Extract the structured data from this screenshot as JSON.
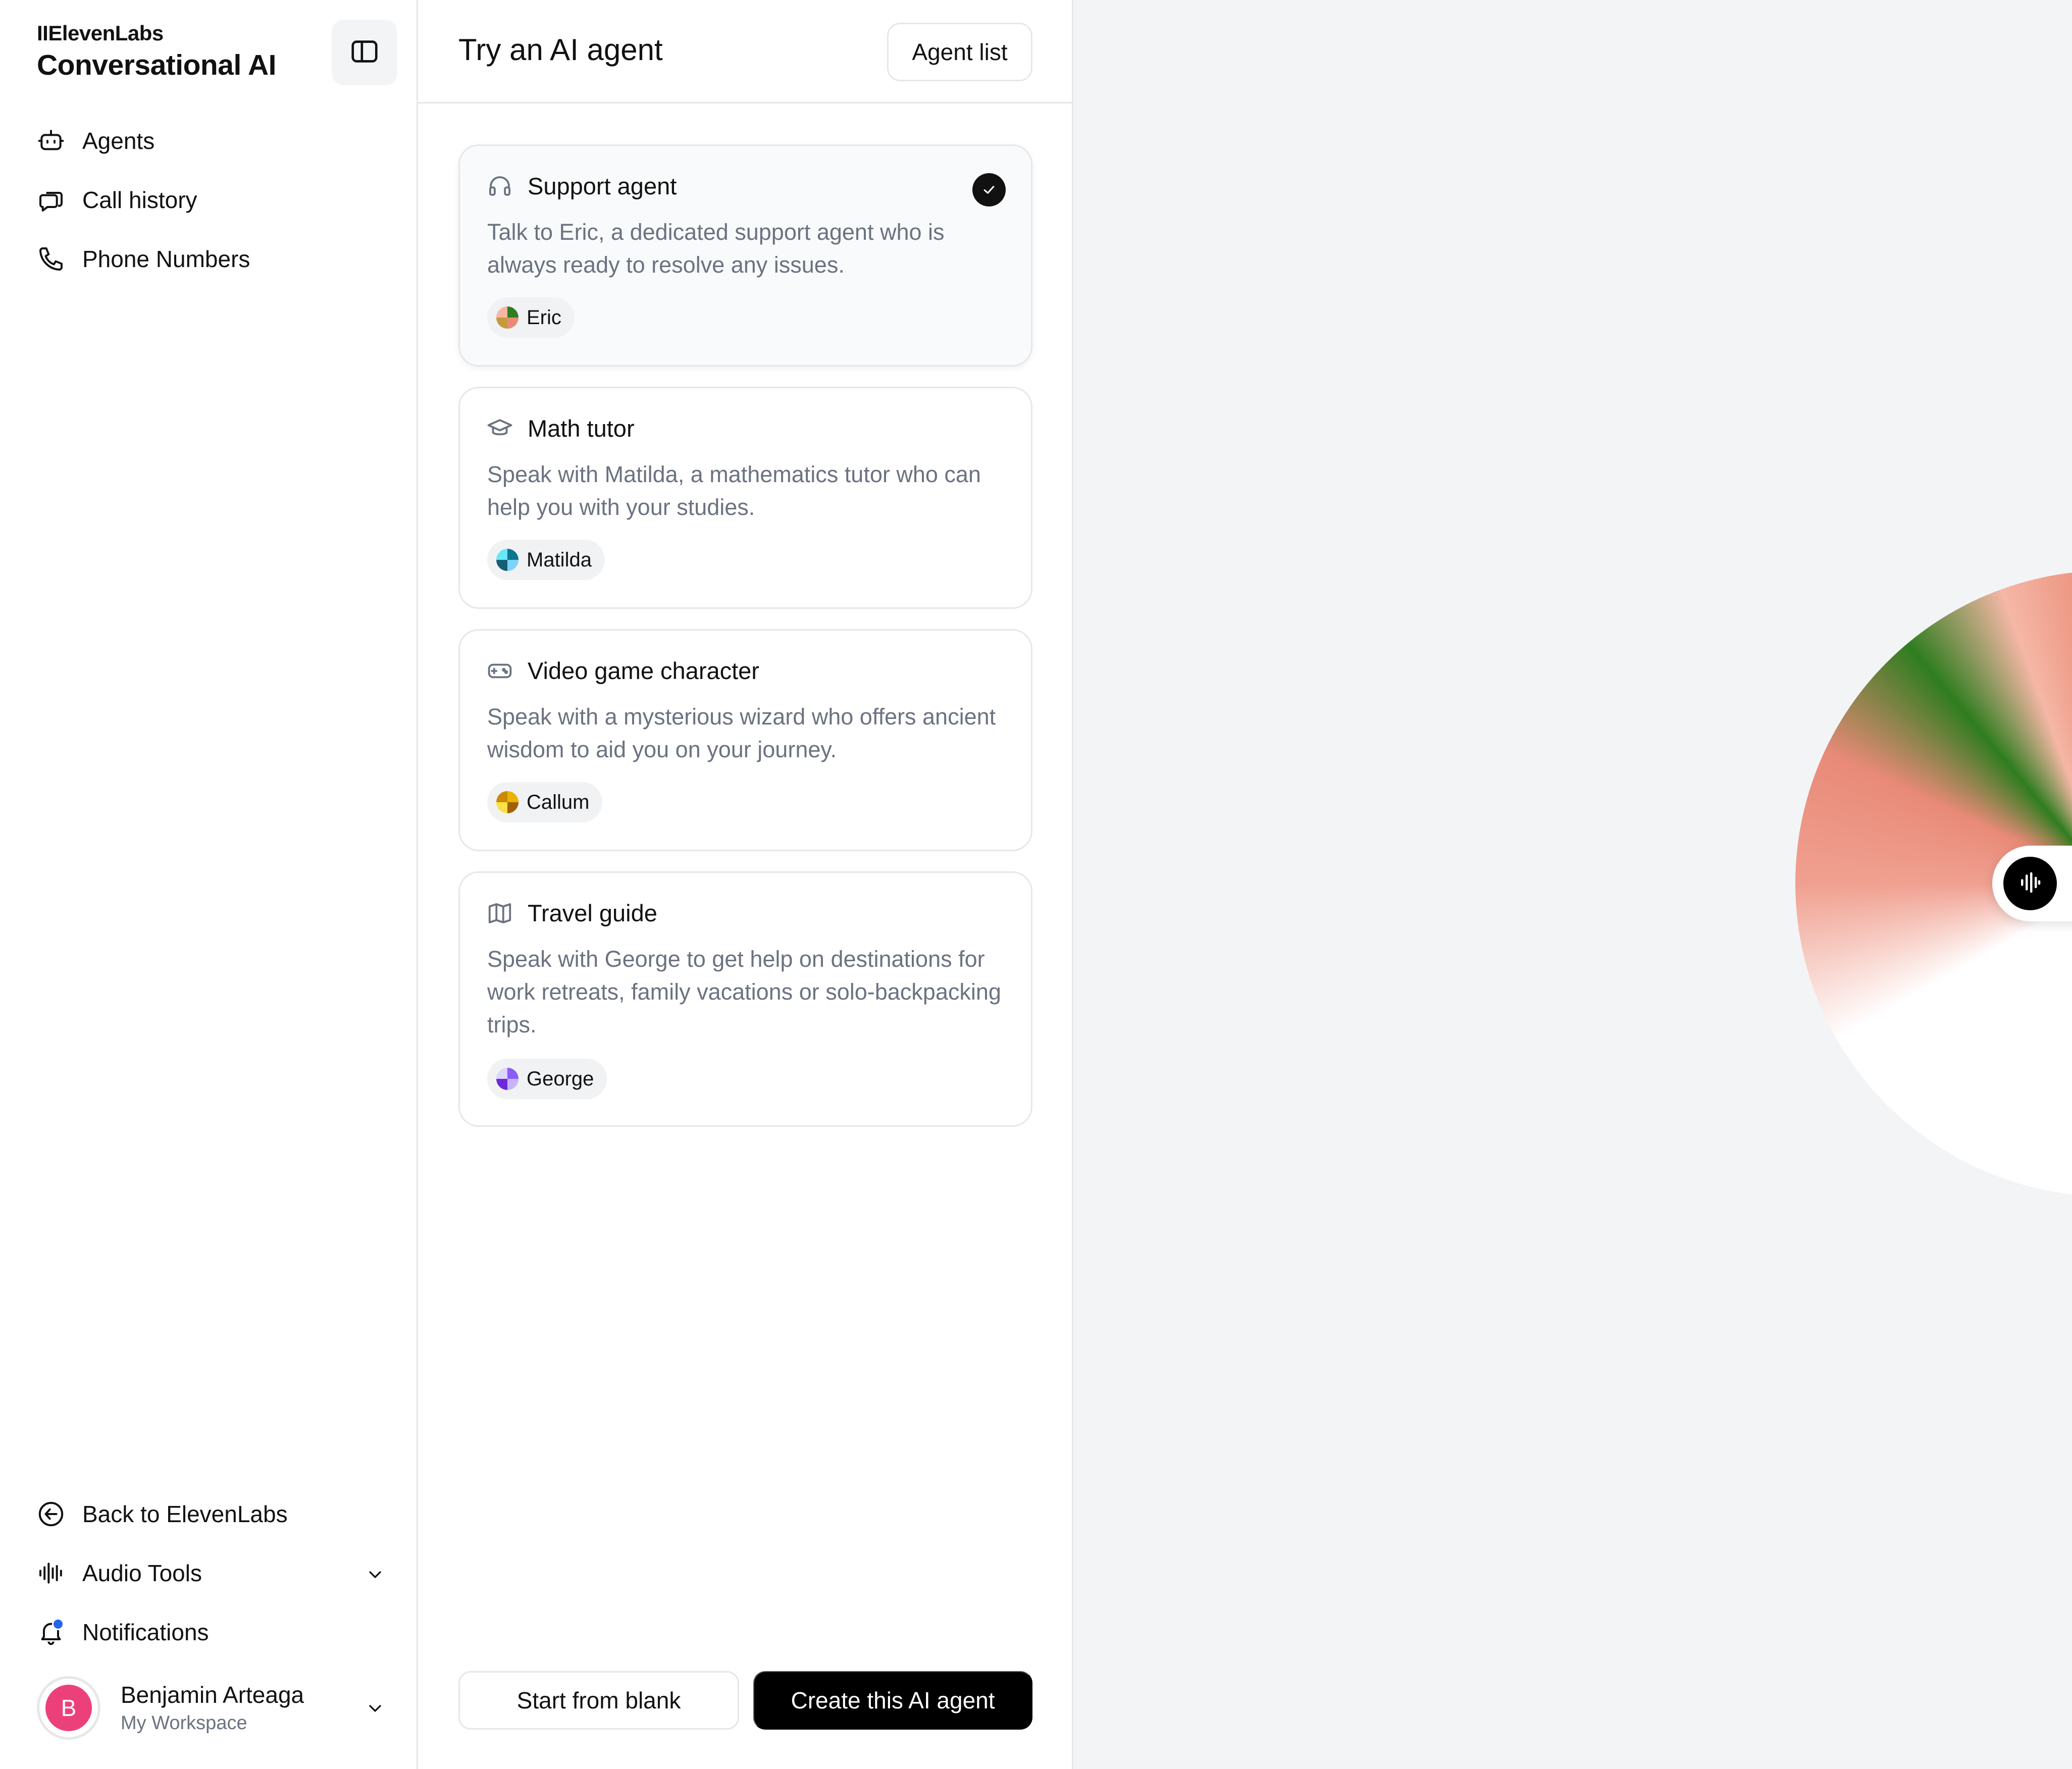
{
  "brand": {
    "small": "IIElevenLabs",
    "large": "Conversational AI"
  },
  "nav": {
    "agents": "Agents",
    "call_history": "Call history",
    "phone_numbers": "Phone Numbers",
    "back": "Back to ElevenLabs",
    "audio_tools": "Audio Tools",
    "notifications": "Notifications"
  },
  "user": {
    "initial": "B",
    "name": "Benjamin Arteaga",
    "workspace": "My Workspace"
  },
  "panel": {
    "title": "Try an AI agent",
    "agent_list_label": "Agent list",
    "start_blank_label": "Start from blank",
    "create_label": "Create this AI agent"
  },
  "cards": [
    {
      "title": "Support agent",
      "desc": "Talk to Eric, a dedicated support agent who is always ready to resolve any issues.",
      "voice": "Eric",
      "selected": true
    },
    {
      "title": "Math tutor",
      "desc": "Speak with Matilda, a mathematics tutor who can help you with your studies.",
      "voice": "Matilda",
      "selected": false
    },
    {
      "title": "Video game character",
      "desc": "Speak with a mysterious wizard who offers ancient wisdom to aid you on your journey.",
      "voice": "Callum",
      "selected": false
    },
    {
      "title": "Travel guide",
      "desc": "Speak with George to get help on destinations for work retreats, family vacations or solo-backpacking trips.",
      "voice": "George",
      "selected": false
    }
  ],
  "colors": {
    "accent": "#000000",
    "avatar": "#ec407a",
    "notification_dot": "#2563eb",
    "background": "#f3f4f6"
  },
  "icons": [
    "sidebar-toggle-icon",
    "bot-icon",
    "chat-bubbles-icon",
    "phone-icon",
    "arrow-left-circle-icon",
    "waveform-icon",
    "bell-icon",
    "chevron-down-icon",
    "headset-icon",
    "graduation-cap-icon",
    "gamepad-icon",
    "map-icon",
    "check-icon"
  ]
}
